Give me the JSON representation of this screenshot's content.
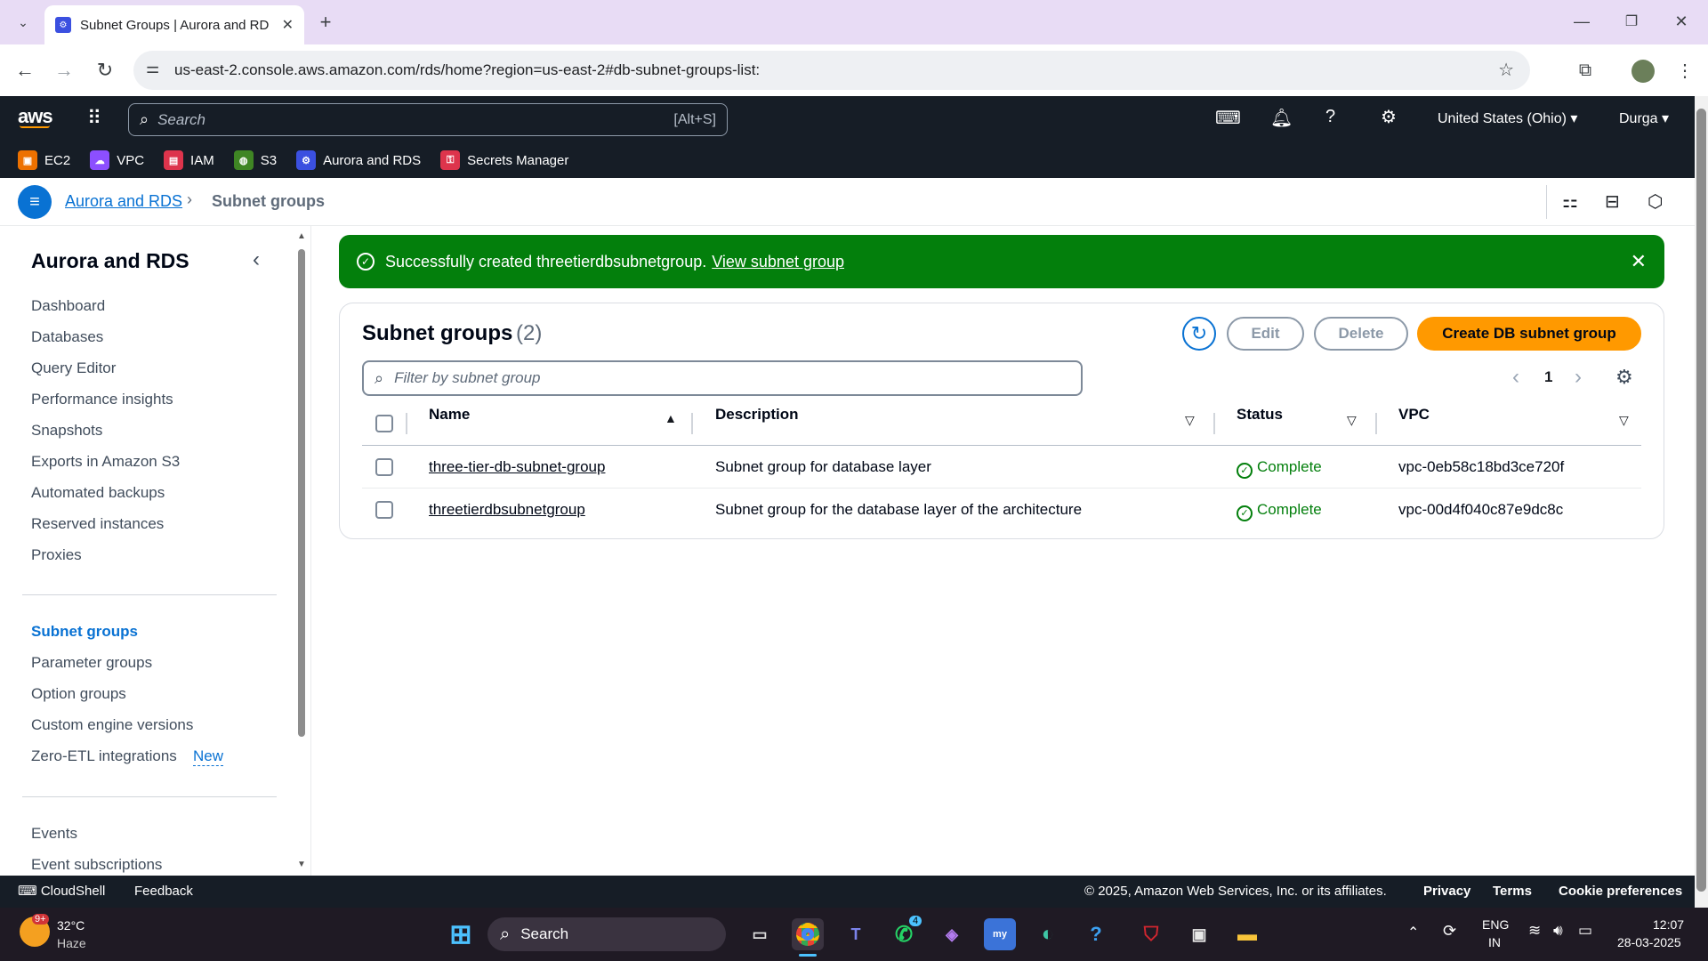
{
  "browser": {
    "tab_title": "Subnet Groups | Aurora and RD",
    "url": "us-east-2.console.aws.amazon.com/rds/home?region=us-east-2#db-subnet-groups-list:"
  },
  "aws": {
    "logo": "aws",
    "search_placeholder": "Search",
    "search_shortcut": "[Alt+S]",
    "region": "United States (Ohio)",
    "user": "Durga",
    "favorites": [
      {
        "label": "EC2",
        "color": "#ed7100"
      },
      {
        "label": "VPC",
        "color": "#8c4fff"
      },
      {
        "label": "IAM",
        "color": "#dd344c"
      },
      {
        "label": "S3",
        "color": "#3f8624"
      },
      {
        "label": "Aurora and RDS",
        "color": "#3b50e0"
      },
      {
        "label": "Secrets Manager",
        "color": "#dd344c"
      }
    ]
  },
  "breadcrumb": {
    "root": "Aurora and RDS",
    "current": "Subnet groups"
  },
  "sidebar": {
    "title": "Aurora and RDS",
    "items": [
      "Dashboard",
      "Databases",
      "Query Editor",
      "Performance insights",
      "Snapshots",
      "Exports in Amazon S3",
      "Automated backups",
      "Reserved instances",
      "Proxies"
    ],
    "items2": [
      "Subnet groups",
      "Parameter groups",
      "Option groups",
      "Custom engine versions",
      "Zero-ETL integrations"
    ],
    "new_badge": "New",
    "items3": [
      "Events",
      "Event subscriptions"
    ]
  },
  "flash": {
    "message": "Successfully created threetierdbsubnetgroup.",
    "link": "View subnet group"
  },
  "panel": {
    "title": "Subnet groups",
    "count": "(2)",
    "edit": "Edit",
    "delete": "Delete",
    "create": "Create DB subnet group",
    "filter_placeholder": "Filter by subnet group",
    "page": "1",
    "columns": [
      "Name",
      "Description",
      "Status",
      "VPC"
    ],
    "rows": [
      {
        "name": "three-tier-db-subnet-group",
        "description": "Subnet group for database layer",
        "status": "Complete",
        "vpc": "vpc-0eb58c18bd3ce720f"
      },
      {
        "name": "threetierdbsubnetgroup",
        "description": "Subnet group for the database layer of the architecture",
        "status": "Complete",
        "vpc": "vpc-00d4f040c87e9dc8c"
      }
    ]
  },
  "footer": {
    "cloudshell": "CloudShell",
    "feedback": "Feedback",
    "copyright": "© 2025, Amazon Web Services, Inc. or its affiliates.",
    "privacy": "Privacy",
    "terms": "Terms",
    "cookies": "Cookie preferences"
  },
  "taskbar": {
    "weather_temp": "32°C",
    "weather_desc": "Haze",
    "weather_badge": "9+",
    "search": "Search",
    "whatsapp_badge": "4",
    "lang1": "ENG",
    "lang2": "IN",
    "time": "12:07",
    "date": "28-03-2025"
  }
}
